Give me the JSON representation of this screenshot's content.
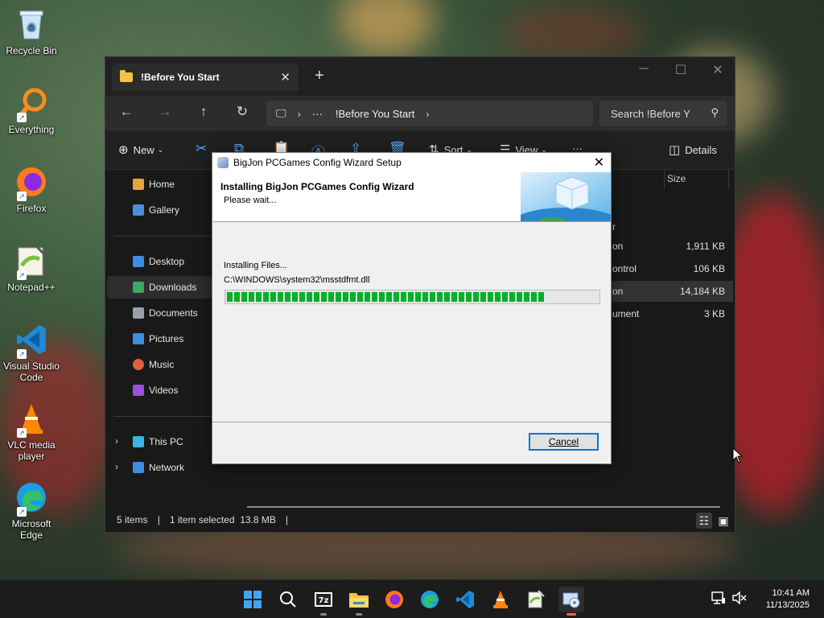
{
  "desktop": {
    "icons": [
      {
        "label": "Recycle Bin"
      },
      {
        "label": "Everything"
      },
      {
        "label": "Firefox"
      },
      {
        "label": "Notepad++"
      },
      {
        "label": "Visual Studio Code"
      },
      {
        "label": "VLC media player"
      },
      {
        "label": "Microsoft Edge"
      }
    ]
  },
  "explorer": {
    "tab_title": "!Before You Start",
    "address_path": "!Before You Start",
    "search_placeholder": "Search !Before Y",
    "toolbar": {
      "new_label": "New",
      "sort_label": "Sort",
      "view_label": "View",
      "details_label": "Details"
    },
    "sidebar": {
      "items": [
        {
          "label": "Home"
        },
        {
          "label": "Gallery"
        },
        {
          "label": "Desktop"
        },
        {
          "label": "Downloads"
        },
        {
          "label": "Documents"
        },
        {
          "label": "Pictures"
        },
        {
          "label": "Music"
        },
        {
          "label": "Videos"
        },
        {
          "label": "This PC"
        },
        {
          "label": "Network"
        }
      ]
    },
    "columns": {
      "size": "Size"
    },
    "rows": [
      {
        "type": "r",
        "size": ""
      },
      {
        "type": "on",
        "size": "1,911 KB"
      },
      {
        "type": "ontrol",
        "size": "106 KB"
      },
      {
        "type": "on",
        "size": "14,184 KB"
      },
      {
        "type": "ument",
        "size": "3 KB"
      }
    ],
    "status": {
      "items": "5 items",
      "selected": "1 item selected  13.8 MB"
    }
  },
  "dialog": {
    "title": "BigJon PCGames Config Wizard Setup",
    "heading": "Installing BigJon PCGames Config Wizard",
    "subheading": "Please wait...",
    "status_text": "Installing Files...",
    "current_file": "C:\\WINDOWS\\system32\\msstdfmt.dll",
    "progress": 0.86,
    "cancel_label": "Cancel"
  },
  "taskbar": {
    "apps": [
      "start-icon",
      "search-icon",
      "7zip-icon",
      "file-explorer-icon",
      "firefox-icon",
      "edge-icon",
      "vscode-icon",
      "vlc-icon",
      "notepadpp-icon",
      "installer-icon"
    ],
    "time": "10:41 AM",
    "date": "11/13/2025"
  },
  "colors": {
    "progress_green": "#06b025",
    "accent_blue": "#0078d7",
    "explorer_bg": "#191919"
  }
}
